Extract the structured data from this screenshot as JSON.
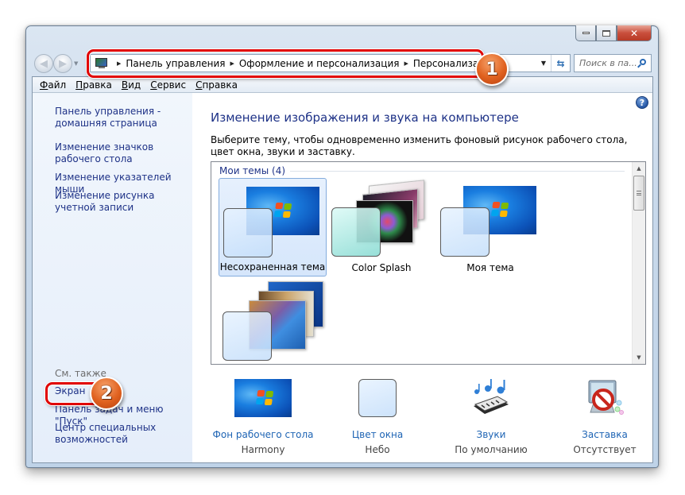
{
  "window": {
    "controls": {
      "minimize": "minimize",
      "maximize": "maximize",
      "close": "close"
    }
  },
  "navigation": {
    "back_icon": "back-arrow-icon",
    "forward_icon": "forward-arrow-icon",
    "breadcrumb": [
      "Панель управления",
      "Оформление и персонализация",
      "Персонализация"
    ],
    "search_placeholder": "Поиск в па..."
  },
  "menubar": {
    "items": [
      "Файл",
      "Правка",
      "Вид",
      "Сервис",
      "Справка"
    ]
  },
  "sidebar": {
    "links": [
      "Панель управления - домашняя страница",
      "Изменение значков рабочего стола",
      "Изменение указателей мыши",
      "Изменение рисунка учетной записи"
    ],
    "see_also_label": "См. также",
    "see_also_links": [
      "Экран",
      "Панель задач и меню \"Пуск\"",
      "Центр специальных возможностей"
    ]
  },
  "main": {
    "title": "Изменение изображения и звука на компьютере",
    "description": "Выберите тему, чтобы одновременно изменить фоновый рисунок рабочего стола, цвет окна, звуки и заставку.",
    "group_header": "Мои темы (4)",
    "themes": [
      {
        "name": "Несохраненная тема",
        "selected": true
      },
      {
        "name": "Color Splash",
        "selected": false
      },
      {
        "name": "Моя тема",
        "selected": false
      },
      {
        "name": "",
        "selected": false
      }
    ],
    "settings": [
      {
        "link": "Фон рабочего стола",
        "value": "Harmony"
      },
      {
        "link": "Цвет окна",
        "value": "Небо"
      },
      {
        "link": "Звуки",
        "value": "По умолчанию"
      },
      {
        "link": "Заставка",
        "value": "Отсутствует"
      }
    ]
  },
  "annotations": {
    "badge1": "1",
    "badge2": "2"
  }
}
